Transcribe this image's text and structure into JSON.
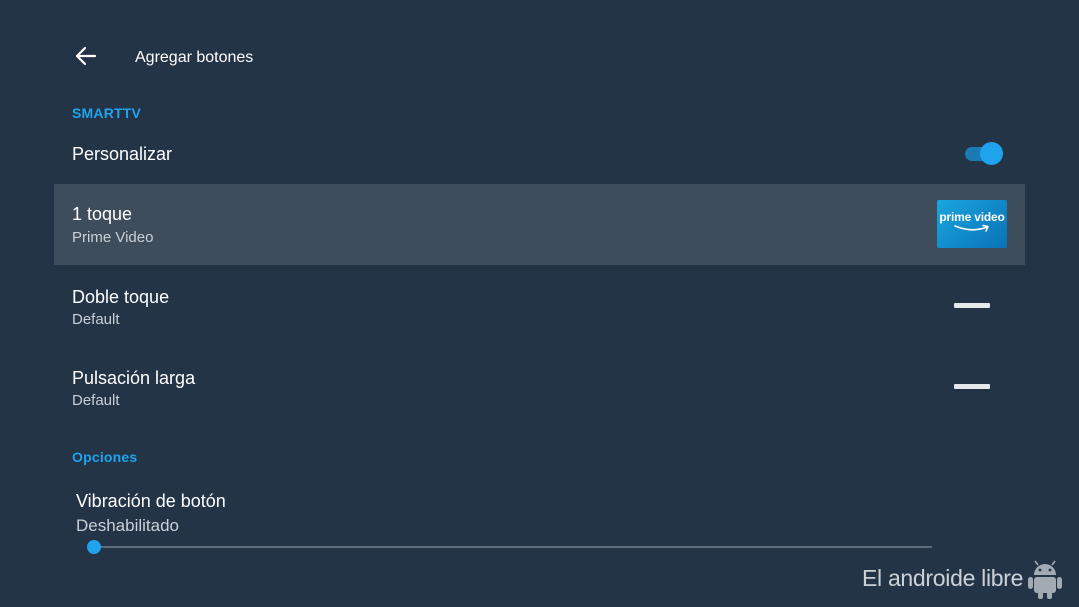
{
  "header": {
    "back_icon": "arrow-back-icon",
    "title": "Agregar botones"
  },
  "sections": {
    "smarttv": "SMARTTV",
    "options": "Opciones"
  },
  "personalize": {
    "label": "Personalizar",
    "enabled": true
  },
  "rows": [
    {
      "title": "1 toque",
      "subtitle": "Prime Video",
      "icon": "prime-video-logo",
      "focused": true
    },
    {
      "title": "Doble toque",
      "subtitle": "Default",
      "icon": "dash-icon",
      "focused": false
    },
    {
      "title": "Pulsación larga",
      "subtitle": "Default",
      "icon": "dash-icon",
      "focused": false
    }
  ],
  "prime_logo_text": "prime video",
  "vibration": {
    "title": "Vibración de botón",
    "value_label": "Deshabilitado",
    "level": 0
  },
  "watermark": {
    "text": "El androide libre"
  },
  "colors": {
    "background": "#243447",
    "accent": "#1fa3ec",
    "focused_row": "#3e4d5c"
  }
}
